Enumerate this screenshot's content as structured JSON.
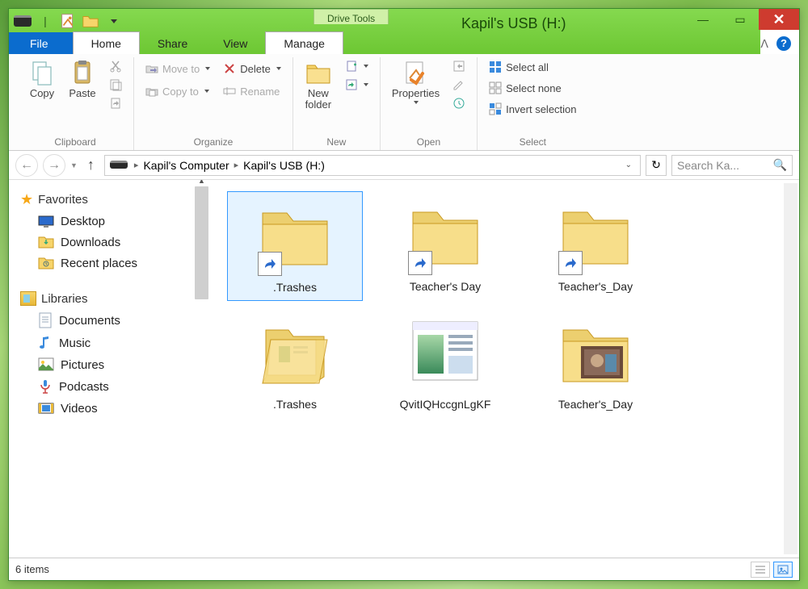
{
  "window": {
    "drive_tools_label": "Drive Tools",
    "title": "Kapil's USB (H:)"
  },
  "tabs": {
    "file": "File",
    "home": "Home",
    "share": "Share",
    "view": "View",
    "manage": "Manage"
  },
  "ribbon": {
    "clipboard": {
      "copy": "Copy",
      "paste": "Paste",
      "label": "Clipboard"
    },
    "organize": {
      "move_to": "Move to",
      "copy_to": "Copy to",
      "delete": "Delete",
      "rename": "Rename",
      "label": "Organize"
    },
    "new": {
      "new_folder": "New\nfolder",
      "label": "New"
    },
    "open": {
      "properties": "Properties",
      "label": "Open"
    },
    "select": {
      "select_all": "Select all",
      "select_none": "Select none",
      "invert": "Invert selection",
      "label": "Select"
    }
  },
  "address": {
    "part1": "Kapil's Computer",
    "part2": "Kapil's USB (H:)"
  },
  "search": {
    "placeholder": "Search Ka..."
  },
  "sidebar": {
    "favorites": "Favorites",
    "desktop": "Desktop",
    "downloads": "Downloads",
    "recent": "Recent places",
    "libraries": "Libraries",
    "documents": "Documents",
    "music": "Music",
    "pictures": "Pictures",
    "podcasts": "Podcasts",
    "videos": "Videos"
  },
  "items": {
    "0": ".Trashes",
    "1": "Teacher's Day",
    "2": "Teacher's_Day",
    "3": ".Trashes",
    "4": "QvitIQHccgnLgKF",
    "5": "Teacher's_Day"
  },
  "status": {
    "count": "6 items"
  }
}
